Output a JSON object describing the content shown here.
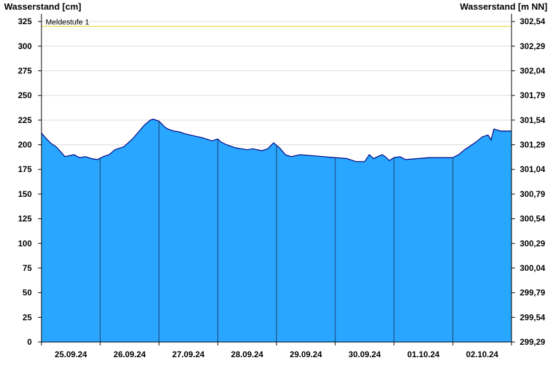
{
  "chart_data": {
    "type": "area",
    "left_axis_title": "Wasserstand [cm]",
    "right_axis_title": "Wasserstand [m NN]",
    "ylim": [
      0,
      330
    ],
    "y_ticks": [
      0,
      25,
      50,
      75,
      100,
      125,
      150,
      175,
      200,
      225,
      250,
      275,
      300,
      325
    ],
    "y_right_ticks": [
      "299,29",
      "299,54",
      "299,79",
      "300,04",
      "300,29",
      "300,54",
      "300,79",
      "301,04",
      "301,29",
      "301,54",
      "301,79",
      "302,04",
      "302,29",
      "302,54"
    ],
    "x_range": [
      0,
      8
    ],
    "x_tick_labels": [
      "25.09.24",
      "26.09.24",
      "27.09.24",
      "28.09.24",
      "29.09.24",
      "30.09.24",
      "01.10.24",
      "02.10.24"
    ],
    "grid": true,
    "threshold": {
      "label": "Meldestufe 1",
      "value": 320,
      "color": "#e8d44d"
    },
    "fill_color": "#29a6ff",
    "line_color": "#000080",
    "series": [
      {
        "x": [
          0.0,
          0.07,
          0.15,
          0.25,
          0.4,
          0.55,
          0.65,
          0.75,
          0.85,
          0.95,
          1.05,
          1.15,
          1.25,
          1.4,
          1.55,
          1.65,
          1.75,
          1.85,
          1.9,
          2.0,
          2.05,
          2.1,
          2.15,
          2.25,
          2.35,
          2.45,
          2.6,
          2.75,
          2.9,
          3.0,
          3.05,
          3.15,
          3.3,
          3.5,
          3.6,
          3.75,
          3.85,
          3.95,
          4.05,
          4.15,
          4.25,
          4.4,
          4.6,
          4.8,
          5.0,
          5.2,
          5.35,
          5.5,
          5.58,
          5.65,
          5.72,
          5.8,
          5.85,
          5.92,
          6.0,
          6.1,
          6.2,
          6.4,
          6.6,
          6.8,
          7.0,
          7.1,
          7.2,
          7.3,
          7.4,
          7.5,
          7.6,
          7.65,
          7.7,
          7.75,
          7.82,
          7.9,
          8.0
        ],
        "y": [
          212,
          207,
          202,
          198,
          188,
          190,
          187,
          188,
          186,
          185,
          188,
          190,
          195,
          198,
          206,
          213,
          220,
          225,
          226,
          224,
          221,
          218,
          216,
          214,
          213,
          211,
          209,
          207,
          204,
          206,
          203,
          200,
          197,
          195,
          196,
          194,
          196,
          202,
          197,
          190,
          188,
          190,
          189,
          188,
          187,
          186,
          183,
          183,
          190,
          186,
          188,
          190,
          188,
          184,
          187,
          188,
          185,
          186,
          187,
          187,
          187,
          190,
          195,
          199,
          203,
          208,
          210,
          205,
          216,
          215,
          214,
          214,
          214
        ]
      }
    ]
  }
}
